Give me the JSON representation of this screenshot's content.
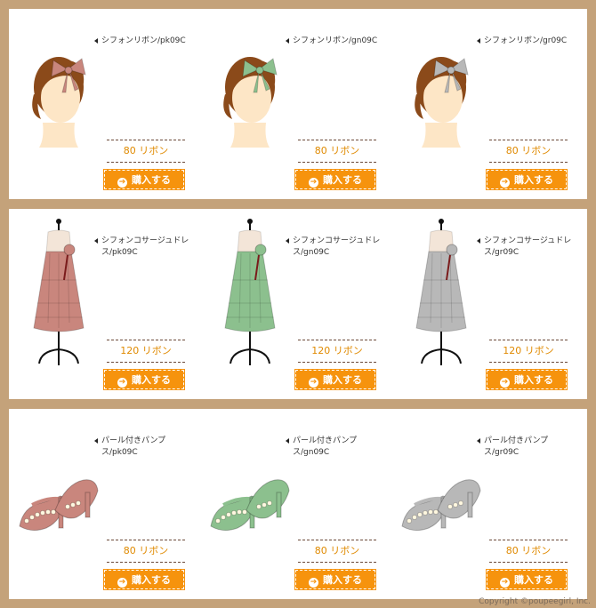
{
  "button_label": "購入する",
  "colors": {
    "pk": "#c9867d",
    "gn": "#8cc08e",
    "gr": "#b8b8b8",
    "hair": "#8b4a1a",
    "skin": "#fde6c6",
    "accent": "#f6930d"
  },
  "rows": [
    {
      "kind": "ribbon",
      "items": [
        {
          "name": "シフォンリボン/pk09C",
          "price": "80 リボン",
          "color": "pk"
        },
        {
          "name": "シフォンリボン/gn09C",
          "price": "80 リボン",
          "color": "gn"
        },
        {
          "name": "シフォンリボン/gr09C",
          "price": "80 リボン",
          "color": "gr"
        }
      ]
    },
    {
      "kind": "dress",
      "items": [
        {
          "name": "シフォンコサージュドレス/pk09C",
          "price": "120 リボン",
          "color": "pk"
        },
        {
          "name": "シフォンコサージュドレス/gn09C",
          "price": "120 リボン",
          "color": "gn"
        },
        {
          "name": "シフォンコサージュドレス/gr09C",
          "price": "120 リボン",
          "color": "gr"
        }
      ]
    },
    {
      "kind": "shoes",
      "items": [
        {
          "name": "パール付きパンプス/pk09C",
          "price": "80 リボン",
          "color": "pk"
        },
        {
          "name": "パール付きパンプス/gn09C",
          "price": "80 リボン",
          "color": "gn"
        },
        {
          "name": "パール付きパンプス/gr09C",
          "price": "80 リボン",
          "color": "gr"
        }
      ]
    }
  ],
  "copyright": "Copyright ©poupeegirl, Inc."
}
